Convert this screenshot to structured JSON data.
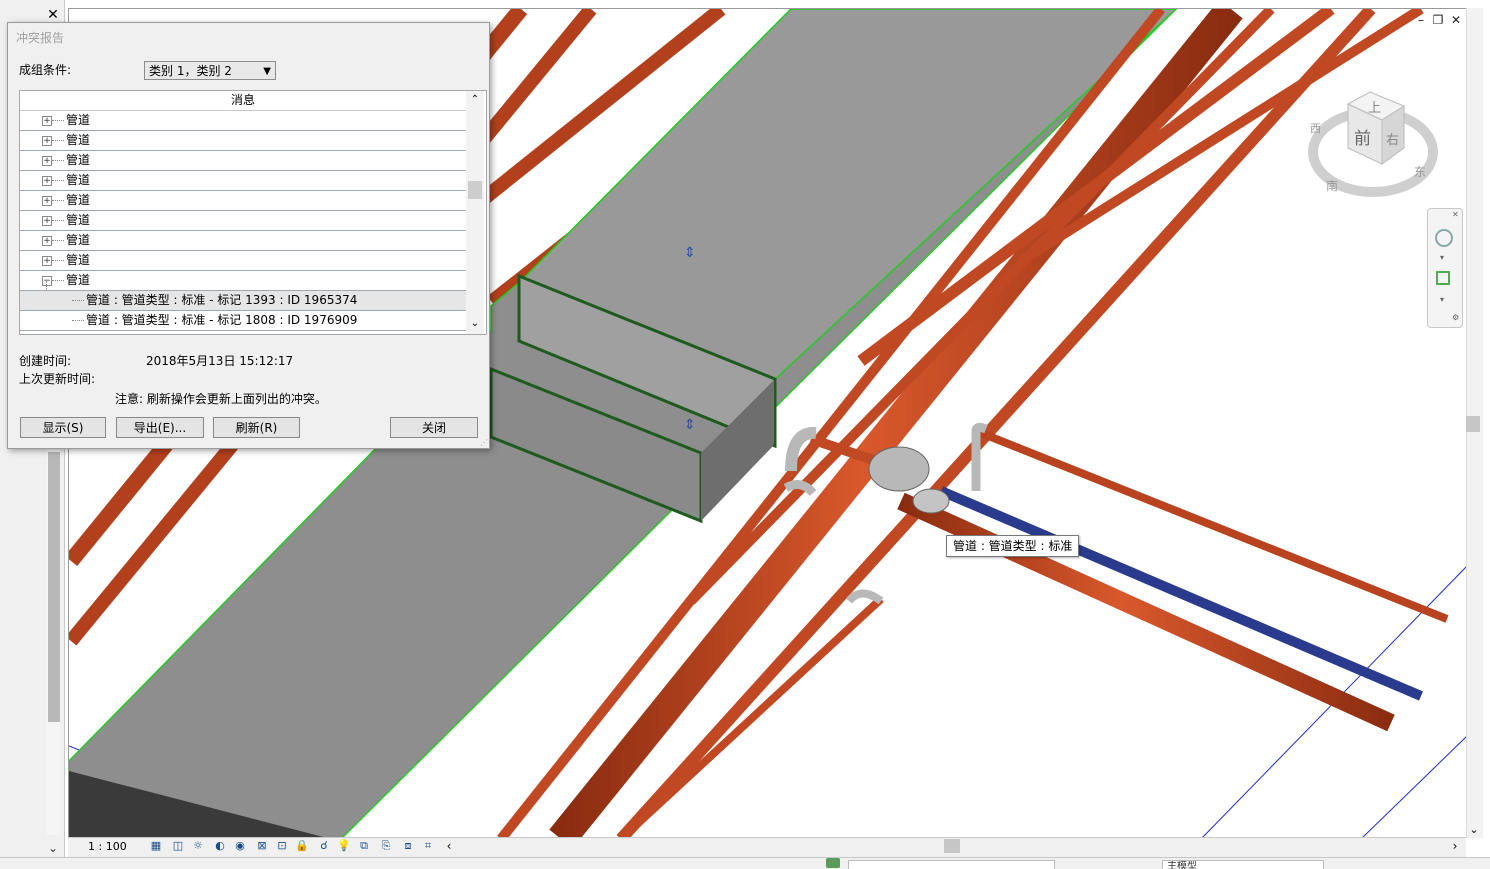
{
  "dialog": {
    "title": "冲突报告",
    "group_label": "成组条件:",
    "group_value": "类别 1，类别 2",
    "column_header": "消息",
    "groups": [
      {
        "label": "管道",
        "expand": "+"
      },
      {
        "label": "管道",
        "expand": "+"
      },
      {
        "label": "管道",
        "expand": "+"
      },
      {
        "label": "管道",
        "expand": "+"
      },
      {
        "label": "管道",
        "expand": "+"
      },
      {
        "label": "管道",
        "expand": "+"
      },
      {
        "label": "管道",
        "expand": "+"
      },
      {
        "label": "管道",
        "expand": "+"
      },
      {
        "label": "管道",
        "expand": "−"
      }
    ],
    "children": [
      "管道 : 管道类型 : 标准 - 标记 1393 : ID 1965374",
      "管道 : 管道类型 : 标准 - 标记 1808 : ID 1976909"
    ],
    "created_label": "创建时间:",
    "created_value": "2018年5月13日  15:12:17",
    "updated_label": "上次更新时间:",
    "note": "注意: 刷新操作会更新上面列出的冲突。",
    "buttons": {
      "show": "显示(S)",
      "export": "导出(E)...",
      "refresh": "刷新(R)",
      "close": "关闭"
    }
  },
  "tooltip": "管道 : 管道类型 : 标准",
  "view_bar": {
    "scale": "1 : 100"
  },
  "viewcube": {
    "top": "上",
    "front": "前",
    "right": "右",
    "compass_s": "南",
    "compass_e": "东",
    "compass_w": "西"
  },
  "status_bar": {
    "model_field": "主模型"
  },
  "colors": {
    "pipe": "#c84a22",
    "pipe_dark": "#8a2c10",
    "duct": "#9a9a9a",
    "duct_side": "#6e6e6e",
    "highlight": "#22cc22",
    "fitting": "#b8b8b8",
    "blue_pipe": "#2a3a8c"
  }
}
